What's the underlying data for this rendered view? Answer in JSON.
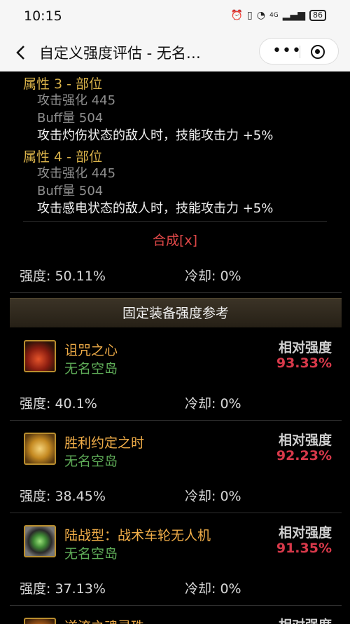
{
  "status": {
    "time": "10:15",
    "net": "4G",
    "battery": "86"
  },
  "nav": {
    "title": "自定义强度评估 - 无名…"
  },
  "attributes": [
    {
      "title": "属性 3 - 部位",
      "line1": "攻击强化   445",
      "line2": "Buff量   504",
      "effect": "攻击灼伤状态的敌人时，技能攻击力 +5%"
    },
    {
      "title": "属性 4 - 部位",
      "line1": "攻击强化   445",
      "line2": "Buff量   504",
      "effect": "攻击感电状态的敌人时，技能攻击力 +5%"
    }
  ],
  "synthesis": {
    "label": "合成[x]"
  },
  "summary": {
    "strength": "强度: 50.11%",
    "cooldown": "冷却: 0%"
  },
  "section": {
    "title": "固定装备强度参考"
  },
  "equipment": [
    {
      "name": "诅咒之心",
      "source": "无名空岛",
      "rel_label": "相对强度",
      "rel_value": "93.33%",
      "strength": "强度: 40.1%",
      "cooldown": "冷却: 0%",
      "icon": "cursed-heart-icon",
      "color": "#c23a1c"
    },
    {
      "name": "胜利约定之时",
      "source": "无名空岛",
      "rel_label": "相对强度",
      "rel_value": "92.23%",
      "strength": "强度: 38.45%",
      "cooldown": "冷却: 0%",
      "icon": "pocket-watch-icon",
      "color": "#d89a2a"
    },
    {
      "name": "陆战型：战术车轮无人机",
      "source": "无名空岛",
      "rel_label": "相对强度",
      "rel_value": "91.35%",
      "strength": "强度: 37.13%",
      "cooldown": "冷却: 0%",
      "icon": "wheel-drone-icon",
      "color": "#5aa84a"
    },
    {
      "name": "逆流之魂灵珠",
      "source": "",
      "rel_label": "相对强度",
      "rel_value": "",
      "strength": "",
      "cooldown": "",
      "icon": "soul-orb-icon",
      "color": "#d88a2a"
    }
  ]
}
